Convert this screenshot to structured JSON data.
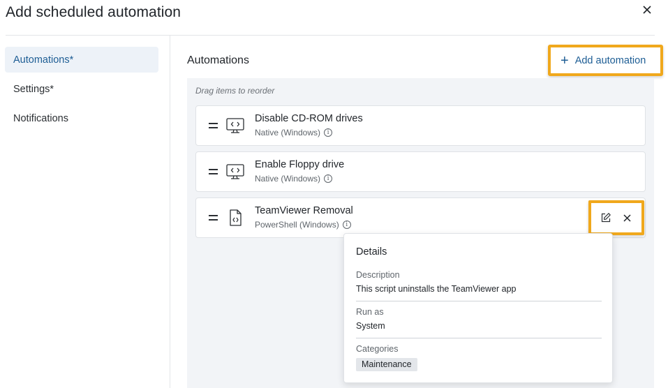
{
  "dialog": {
    "title": "Add scheduled automation"
  },
  "sidebar": {
    "items": [
      {
        "label": "Automations*",
        "active": true
      },
      {
        "label": "Settings*",
        "active": false
      },
      {
        "label": "Notifications",
        "active": false
      }
    ]
  },
  "main": {
    "section_title": "Automations",
    "add_button_label": "Add automation",
    "drag_hint": "Drag items to reorder",
    "automations": [
      {
        "name": "Disable CD-ROM drives",
        "type": "Native (Windows)",
        "icon": "monitor-code-icon"
      },
      {
        "name": "Enable Floppy drive",
        "type": "Native (Windows)",
        "icon": "monitor-code-icon"
      },
      {
        "name": "TeamViewer Removal",
        "type": "PowerShell (Windows)",
        "icon": "script-file-icon"
      }
    ]
  },
  "details": {
    "title": "Details",
    "description_label": "Description",
    "description_value": "This script uninstalls the TeamViewer app",
    "run_as_label": "Run as",
    "run_as_value": "System",
    "categories_label": "Categories",
    "categories": [
      "Maintenance"
    ]
  },
  "colors": {
    "accent": "#1d5d94",
    "highlight": "#f0a81c",
    "active_bg": "#edf2f8",
    "drop_area_bg": "#f2f4f7"
  }
}
